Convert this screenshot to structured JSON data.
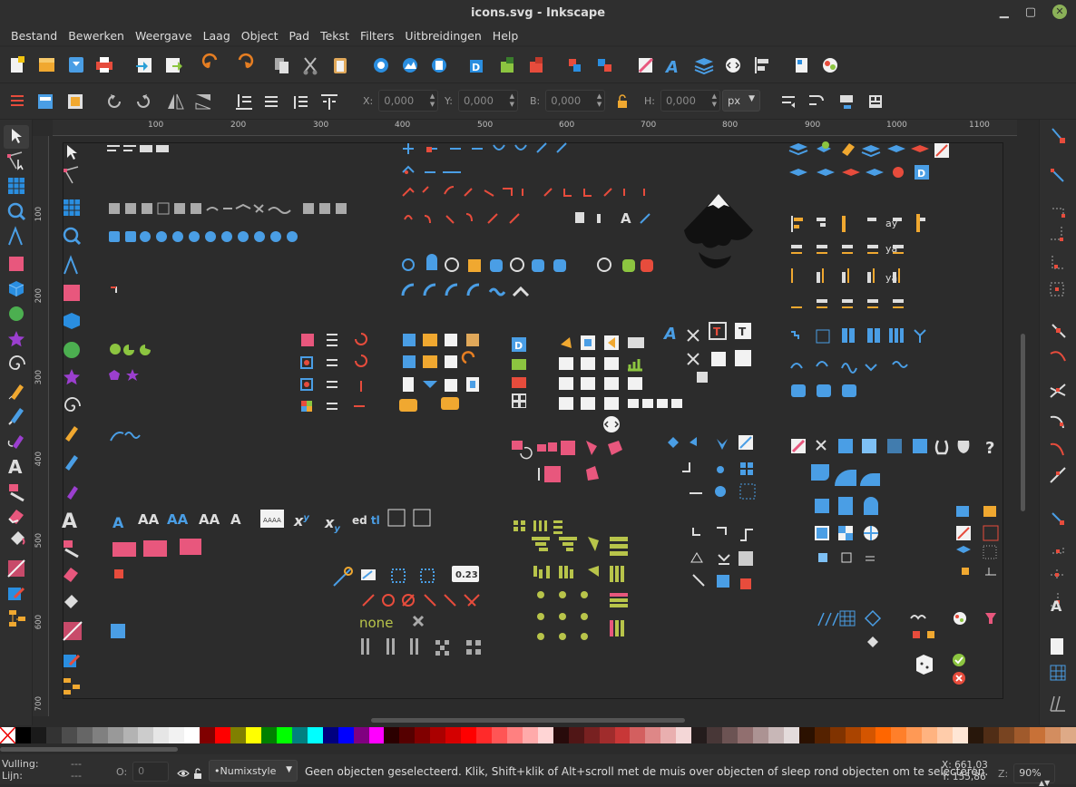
{
  "window": {
    "title": "icons.svg - Inkscape"
  },
  "menu": [
    "Bestand",
    "Bewerken",
    "Weergave",
    "Laag",
    "Object",
    "Pad",
    "Tekst",
    "Filters",
    "Uitbreidingen",
    "Help"
  ],
  "controls": {
    "x_label": "X:",
    "x_value": "0,000",
    "y_label": "Y:",
    "y_value": "0,000",
    "b_label": "B:",
    "b_value": "0,000",
    "h_label": "H:",
    "h_value": "0,000",
    "unit": "px"
  },
  "ruler_top": [
    "100",
    "200",
    "300",
    "400",
    "500",
    "600",
    "700",
    "800",
    "900",
    "1000",
    "1100"
  ],
  "ruler_left": [
    "100",
    "200",
    "300",
    "400",
    "500",
    "600",
    "700"
  ],
  "canvas_text": {
    "none_label": "none",
    "counter": "0.23",
    "aaaa": "AAAA"
  },
  "status": {
    "fill_label": "Vulling:",
    "stroke_label": "Lijn:",
    "fill_value": "---",
    "stroke_value": "---",
    "opacity_label": "O:",
    "opacity_value": "0",
    "layer": "•Numixstyle",
    "message": "Geen objecten geselecteerd. Klik, Shift+klik of Alt+scroll met de muis over objecten of sleep rond objecten om te selecteren.",
    "x_coord": "X: 661,03",
    "y_coord": "Y: 155,86",
    "zoom_label": "Z:",
    "zoom_value": "90%"
  },
  "palette": [
    "#ffffff",
    "#000000",
    "#1a1a1a",
    "#333333",
    "#4d4d4d",
    "#666666",
    "#808080",
    "#999999",
    "#b3b3b3",
    "#cccccc",
    "#e6e6e6",
    "#f2f2f2",
    "#ffffff",
    "#800000",
    "#ff0000",
    "#808000",
    "#ffff00",
    "#008000",
    "#00ff00",
    "#008080",
    "#00ffff",
    "#000080",
    "#0000ff",
    "#800080",
    "#ff00ff",
    "#2b0000",
    "#550000",
    "#800000",
    "#aa0000",
    "#d40000",
    "#ff0000",
    "#ff2a2a",
    "#ff5555",
    "#ff8080",
    "#ffaaaa",
    "#ffd5d5",
    "#280b0b",
    "#501616",
    "#782121",
    "#a02c2c",
    "#c83737",
    "#d35f5f",
    "#de8787",
    "#e9afaf",
    "#f4d7d7",
    "#241c1c",
    "#483737",
    "#6c5353",
    "#916f6f",
    "#ac9393",
    "#c8b7b7",
    "#e3dbdb",
    "#2b1100",
    "#552200",
    "#803300",
    "#aa4400",
    "#d45500",
    "#ff6600",
    "#ff7f2a",
    "#ff9955",
    "#ffb380",
    "#ffccaa",
    "#ffe6d5",
    "#28170b",
    "#502d16",
    "#784421",
    "#a05a2c",
    "#c87137",
    "#d38d5f",
    "#deaa87"
  ]
}
